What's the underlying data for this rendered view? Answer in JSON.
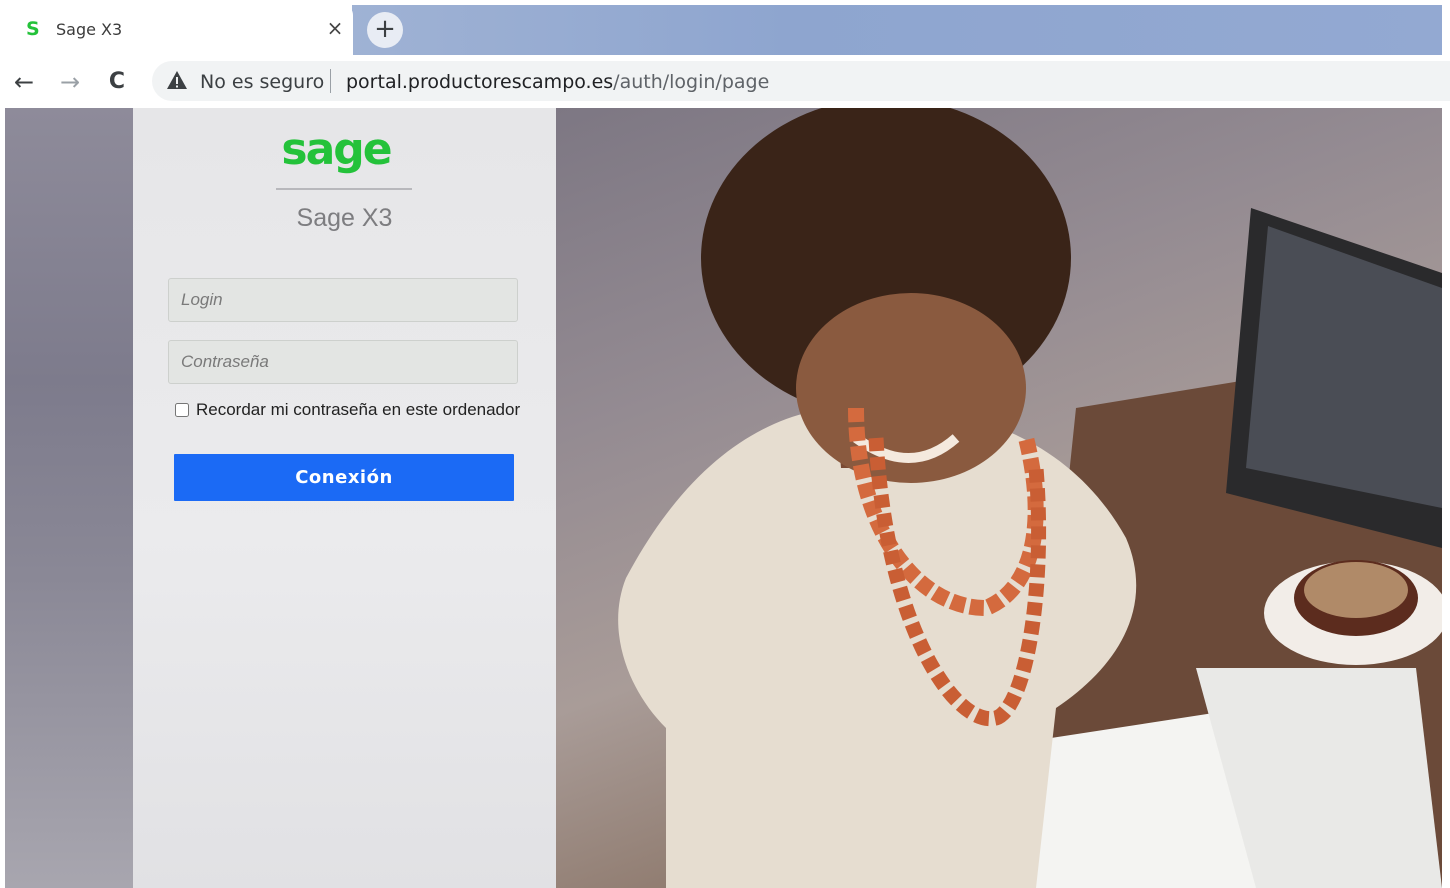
{
  "browser": {
    "tab": {
      "title": "Sage X3",
      "favicon_letter": "S",
      "close_symbol": "×"
    },
    "new_tab_symbol": "+",
    "nav": {
      "back": "←",
      "forward": "→",
      "reload": "C"
    },
    "omnibox": {
      "security_label": "No es seguro",
      "url_host": "portal.productorescampo.es",
      "url_path": "/auth/login/page"
    }
  },
  "login": {
    "product_name": "Sage X3",
    "login_placeholder": "Login",
    "password_placeholder": "Contraseña",
    "remember_label": "Recordar mi contraseña en este ordenador",
    "connect_label": "Conexión"
  },
  "colors": {
    "brand_green": "#24c23a",
    "connect_button": "#1b6af5"
  },
  "icons": {
    "logo": "sage-logo",
    "warning": "warning-triangle-icon"
  }
}
